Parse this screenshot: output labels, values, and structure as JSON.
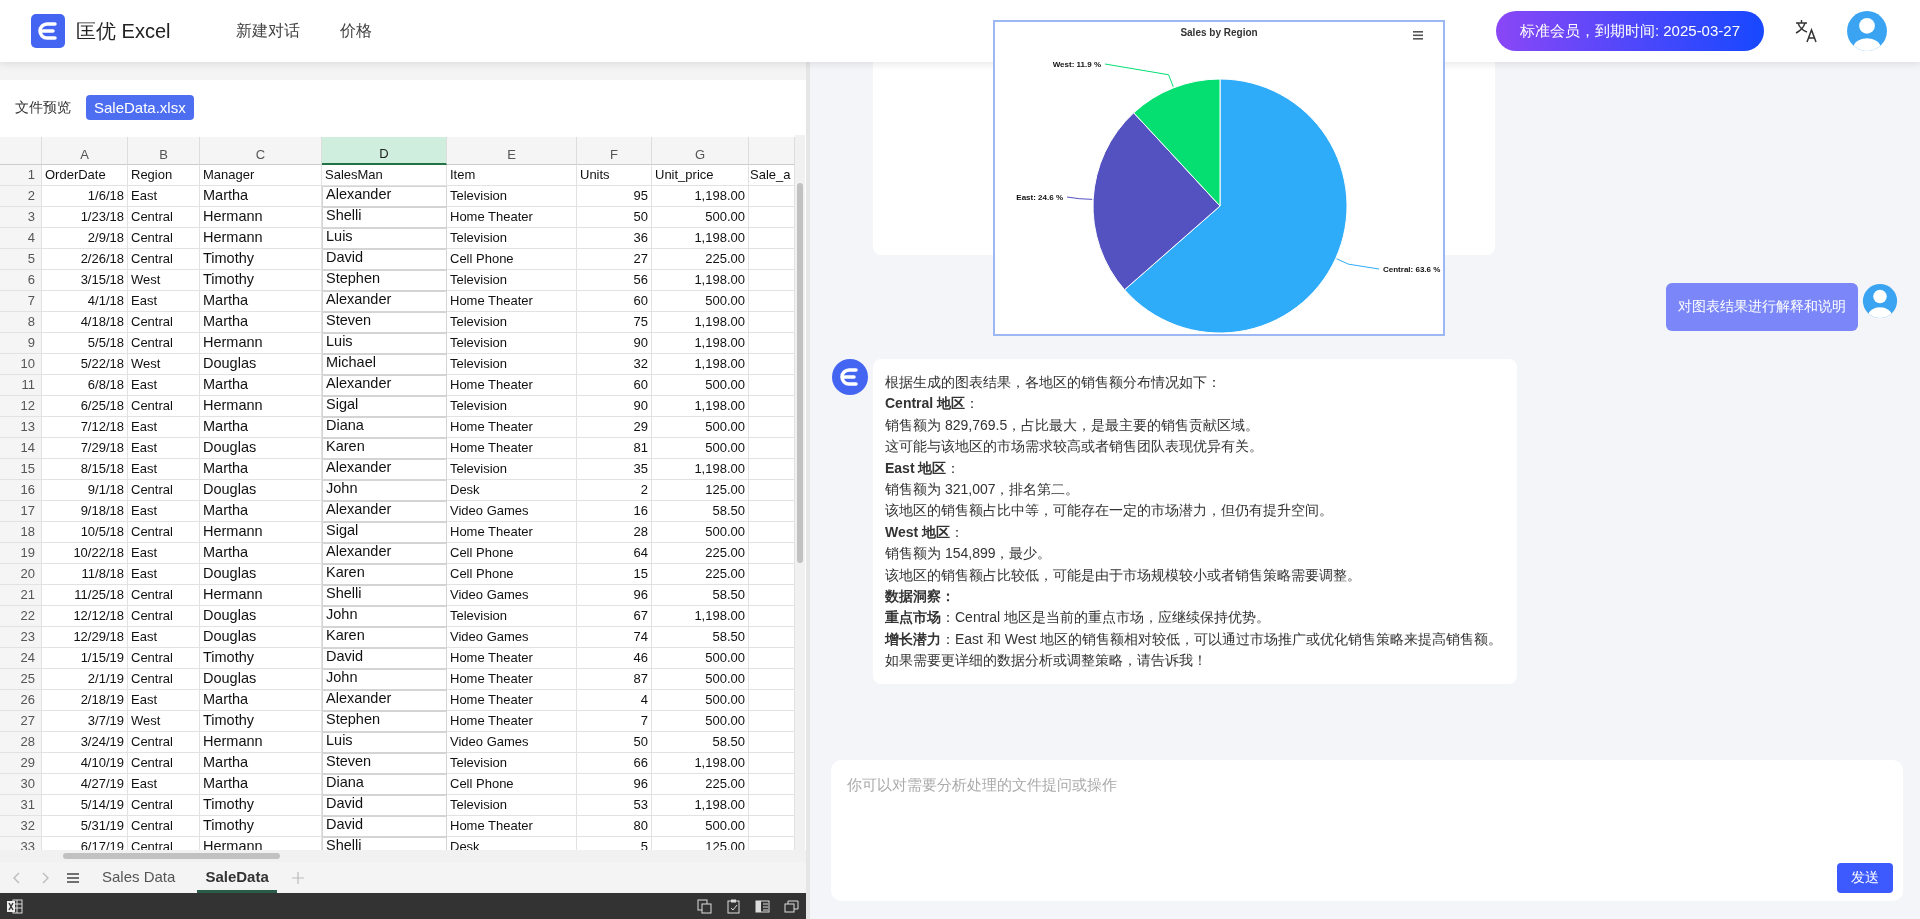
{
  "header": {
    "brand": "匡优 Excel",
    "nav": [
      "新建对话",
      "价格"
    ],
    "membership": "标准会员，到期时间: 2025-03-27"
  },
  "preview": {
    "label": "文件预览",
    "file_tab": {
      "label": "SaleData.xlsx",
      "selected": true
    }
  },
  "sheet": {
    "columns": [
      {
        "label": "A",
        "selected": false
      },
      {
        "label": "B",
        "selected": false
      },
      {
        "label": "C",
        "selected": false
      },
      {
        "label": "D",
        "selected": true
      },
      {
        "label": "E",
        "selected": false
      },
      {
        "label": "F",
        "selected": false
      },
      {
        "label": "G",
        "selected": false
      }
    ],
    "rows": [
      {
        "n": "1",
        "cells": [
          "OrderDate",
          "Region",
          "Manager",
          "SalesMan",
          "Item",
          "Units",
          "Unit_price",
          "Sale_a"
        ]
      },
      {
        "n": "2",
        "cells": [
          "1/6/18",
          "East",
          "Martha",
          "Alexander",
          "Television",
          "95",
          "1,198.00"
        ]
      },
      {
        "n": "3",
        "cells": [
          "1/23/18",
          "Central",
          "Hermann",
          "Shelli",
          "Home Theater",
          "50",
          "500.00"
        ]
      },
      {
        "n": "4",
        "cells": [
          "2/9/18",
          "Central",
          "Hermann",
          "Luis",
          "Television",
          "36",
          "1,198.00"
        ]
      },
      {
        "n": "5",
        "cells": [
          "2/26/18",
          "Central",
          "Timothy",
          "David",
          "Cell Phone",
          "27",
          "225.00"
        ]
      },
      {
        "n": "6",
        "cells": [
          "3/15/18",
          "West",
          "Timothy",
          "Stephen",
          "Television",
          "56",
          "1,198.00"
        ]
      },
      {
        "n": "7",
        "cells": [
          "4/1/18",
          "East",
          "Martha",
          "Alexander",
          "Home Theater",
          "60",
          "500.00"
        ]
      },
      {
        "n": "8",
        "cells": [
          "4/18/18",
          "Central",
          "Martha",
          "Steven",
          "Television",
          "75",
          "1,198.00"
        ]
      },
      {
        "n": "9",
        "cells": [
          "5/5/18",
          "Central",
          "Hermann",
          "Luis",
          "Television",
          "90",
          "1,198.00"
        ]
      },
      {
        "n": "10",
        "cells": [
          "5/22/18",
          "West",
          "Douglas",
          "Michael",
          "Television",
          "32",
          "1,198.00"
        ]
      },
      {
        "n": "11",
        "cells": [
          "6/8/18",
          "East",
          "Martha",
          "Alexander",
          "Home Theater",
          "60",
          "500.00"
        ]
      },
      {
        "n": "12",
        "cells": [
          "6/25/18",
          "Central",
          "Hermann",
          "Sigal",
          "Television",
          "90",
          "1,198.00"
        ]
      },
      {
        "n": "13",
        "cells": [
          "7/12/18",
          "East",
          "Martha",
          "Diana",
          "Home Theater",
          "29",
          "500.00"
        ]
      },
      {
        "n": "14",
        "cells": [
          "7/29/18",
          "East",
          "Douglas",
          "Karen",
          "Home Theater",
          "81",
          "500.00"
        ]
      },
      {
        "n": "15",
        "cells": [
          "8/15/18",
          "East",
          "Martha",
          "Alexander",
          "Television",
          "35",
          "1,198.00"
        ]
      },
      {
        "n": "16",
        "cells": [
          "9/1/18",
          "Central",
          "Douglas",
          "John",
          "Desk",
          "2",
          "125.00"
        ]
      },
      {
        "n": "17",
        "cells": [
          "9/18/18",
          "East",
          "Martha",
          "Alexander",
          "Video Games",
          "16",
          "58.50"
        ]
      },
      {
        "n": "18",
        "cells": [
          "10/5/18",
          "Central",
          "Hermann",
          "Sigal",
          "Home Theater",
          "28",
          "500.00"
        ]
      },
      {
        "n": "19",
        "cells": [
          "10/22/18",
          "East",
          "Martha",
          "Alexander",
          "Cell Phone",
          "64",
          "225.00"
        ]
      },
      {
        "n": "20",
        "cells": [
          "11/8/18",
          "East",
          "Douglas",
          "Karen",
          "Cell Phone",
          "15",
          "225.00"
        ]
      },
      {
        "n": "21",
        "cells": [
          "11/25/18",
          "Central",
          "Hermann",
          "Shelli",
          "Video Games",
          "96",
          "58.50"
        ]
      },
      {
        "n": "22",
        "cells": [
          "12/12/18",
          "Central",
          "Douglas",
          "John",
          "Television",
          "67",
          "1,198.00"
        ]
      },
      {
        "n": "23",
        "cells": [
          "12/29/18",
          "East",
          "Douglas",
          "Karen",
          "Video Games",
          "74",
          "58.50"
        ]
      },
      {
        "n": "24",
        "cells": [
          "1/15/19",
          "Central",
          "Timothy",
          "David",
          "Home Theater",
          "46",
          "500.00"
        ]
      },
      {
        "n": "25",
        "cells": [
          "2/1/19",
          "Central",
          "Douglas",
          "John",
          "Home Theater",
          "87",
          "500.00"
        ]
      },
      {
        "n": "26",
        "cells": [
          "2/18/19",
          "East",
          "Martha",
          "Alexander",
          "Home Theater",
          "4",
          "500.00"
        ]
      },
      {
        "n": "27",
        "cells": [
          "3/7/19",
          "West",
          "Timothy",
          "Stephen",
          "Home Theater",
          "7",
          "500.00"
        ]
      },
      {
        "n": "28",
        "cells": [
          "3/24/19",
          "Central",
          "Hermann",
          "Luis",
          "Video Games",
          "50",
          "58.50"
        ]
      },
      {
        "n": "29",
        "cells": [
          "4/10/19",
          "Central",
          "Martha",
          "Steven",
          "Television",
          "66",
          "1,198.00"
        ]
      },
      {
        "n": "30",
        "cells": [
          "4/27/19",
          "East",
          "Martha",
          "Diana",
          "Cell Phone",
          "96",
          "225.00"
        ]
      },
      {
        "n": "31",
        "cells": [
          "5/14/19",
          "Central",
          "Timothy",
          "David",
          "Television",
          "53",
          "1,198.00"
        ]
      },
      {
        "n": "32",
        "cells": [
          "5/31/19",
          "Central",
          "Timothy",
          "David",
          "Home Theater",
          "80",
          "500.00"
        ]
      },
      {
        "n": "33",
        "cells": [
          "6/17/19",
          "Central",
          "Hermann",
          "Shelli",
          "Desk",
          "5",
          "125.00"
        ]
      }
    ],
    "tabs": [
      {
        "label": "Sales Data",
        "selected": false
      },
      {
        "label": "SaleData",
        "selected": true
      }
    ]
  },
  "chart_popup": {
    "chart_data": {
      "type": "pie",
      "title": "Sales by Region",
      "values": [
        63.6,
        24.6,
        11.9
      ],
      "colors": [
        "#2eabf9",
        "#5352c0",
        "#05df72"
      ],
      "value_labels": [
        "Central: 63.6 %",
        "East: 24.6 %",
        "West: 11.9 %"
      ]
    }
  },
  "chat": {
    "messages": [
      {
        "kind": "user",
        "text": "对图表结果进行解释和说明"
      },
      {
        "kind": "assistant",
        "lines": [
          {
            "kind": "text",
            "text": "根据生成的图表结果，各地区的销售额分布情况如下："
          },
          {
            "kind": "text",
            "text": "**Central 地区**："
          },
          {
            "kind": "text",
            "text": "销售额为 829,769.5，占比最大，是最主要的销售贡献区域。"
          },
          {
            "kind": "text",
            "text": "这可能与该地区的市场需求较高或者销售团队表现优异有关。"
          },
          {
            "kind": "text",
            "text": "**East 地区**："
          },
          {
            "kind": "text",
            "text": "销售额为 321,007，排名第二。"
          },
          {
            "kind": "text",
            "text": "该地区的销售额占比中等，可能存在一定的市场潜力，但仍有提升空间。"
          },
          {
            "kind": "text",
            "text": "**West 地区**："
          },
          {
            "kind": "text",
            "text": "销售额为 154,899，最少。"
          },
          {
            "kind": "text",
            "text": "该地区的销售额占比较低，可能是由于市场规模较小或者销售策略需要调整。"
          },
          {
            "kind": "heading",
            "text": "数据洞察："
          },
          {
            "kind": "text",
            "text": "**重点市场**：Central 地区是当前的重点市场，应继续保持优势。"
          },
          {
            "kind": "text",
            "text": "**增长潜力**：East 和 West 地区的销售额相对较低，可以通过市场推广或优化销售策略来提高销售额。"
          },
          {
            "kind": "text",
            "text": "如果需要更详细的数据分析或调整策略，请告诉我！"
          }
        ]
      }
    ]
  },
  "composer": {
    "placeholder": "你可以对需要分析处理的文件提问或操作",
    "send": "发送"
  }
}
